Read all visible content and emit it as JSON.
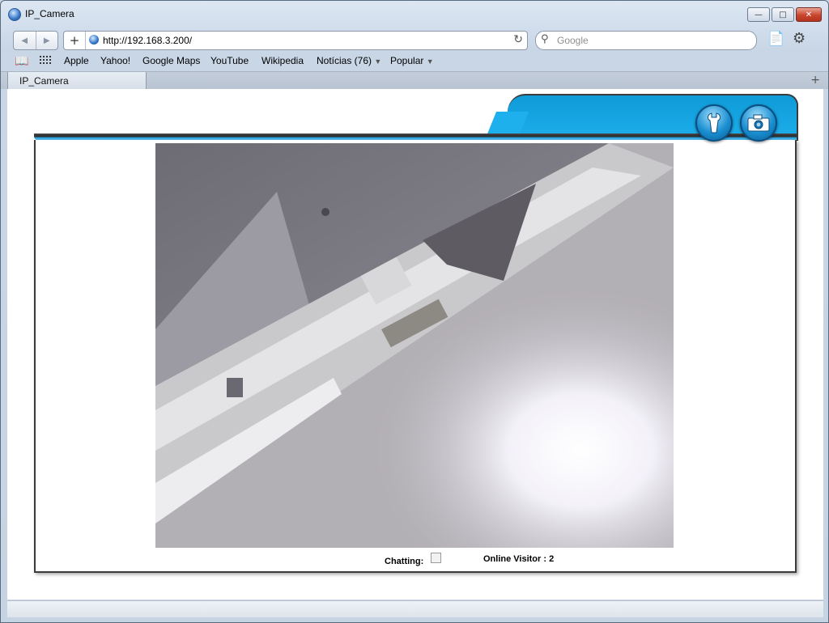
{
  "window": {
    "title": "IP_Camera"
  },
  "toolbar": {
    "url": "http://192.168.3.200/",
    "search_placeholder": "Google"
  },
  "bookmarks": {
    "items": [
      "Apple",
      "Yahoo!",
      "Google Maps",
      "YouTube",
      "Wikipedia",
      "Notícias (76)",
      "Popular"
    ]
  },
  "tabs": [
    {
      "label": "IP_Camera"
    }
  ],
  "camera_page": {
    "chatting_label": "Chatting:",
    "online_visitor_label": "Online Visitor : 2",
    "colors": {
      "accent": "#1db0ec",
      "frame": "#3b3b3b"
    },
    "icons": [
      "settings-wrench-icon",
      "snapshot-camera-icon"
    ]
  }
}
